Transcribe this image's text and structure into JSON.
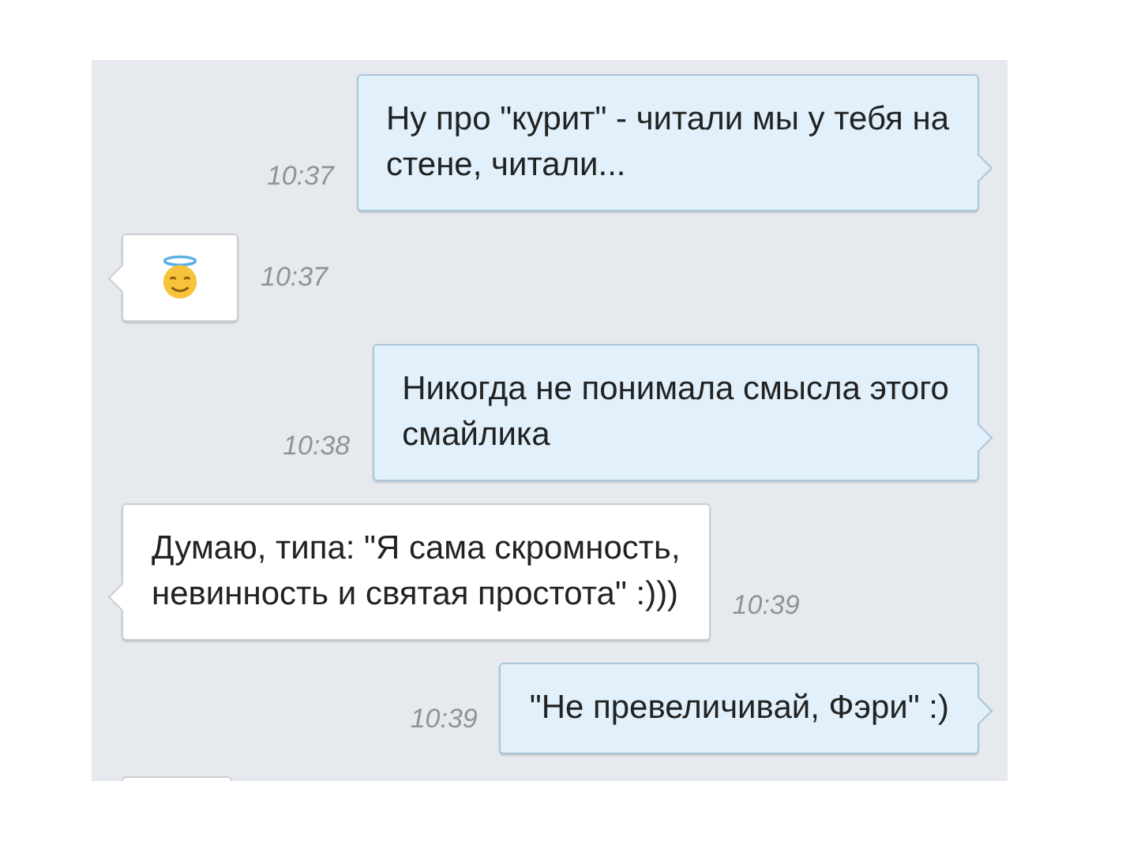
{
  "messages": [
    {
      "outgoing": true,
      "kind": "text",
      "lines": [
        "Ну про \"курит\" - читали мы у тебя на",
        "стене, читали..."
      ],
      "time": "10:37"
    },
    {
      "outgoing": false,
      "kind": "emoji",
      "time": "10:37"
    },
    {
      "outgoing": true,
      "kind": "text",
      "lines": [
        "Никогда не понимала смысла этого",
        "смайлика"
      ],
      "time": "10:38"
    },
    {
      "outgoing": false,
      "kind": "text",
      "lines": [
        "Думаю, типа: \"Я сама скромность,",
        "невинность и святая простота\" :)))"
      ],
      "time": "10:39"
    },
    {
      "outgoing": true,
      "kind": "text",
      "lines": [
        "\"Не превеличивай, Фэри\" :)"
      ],
      "time": "10:39"
    },
    {
      "outgoing": false,
      "kind": "partial"
    }
  ]
}
